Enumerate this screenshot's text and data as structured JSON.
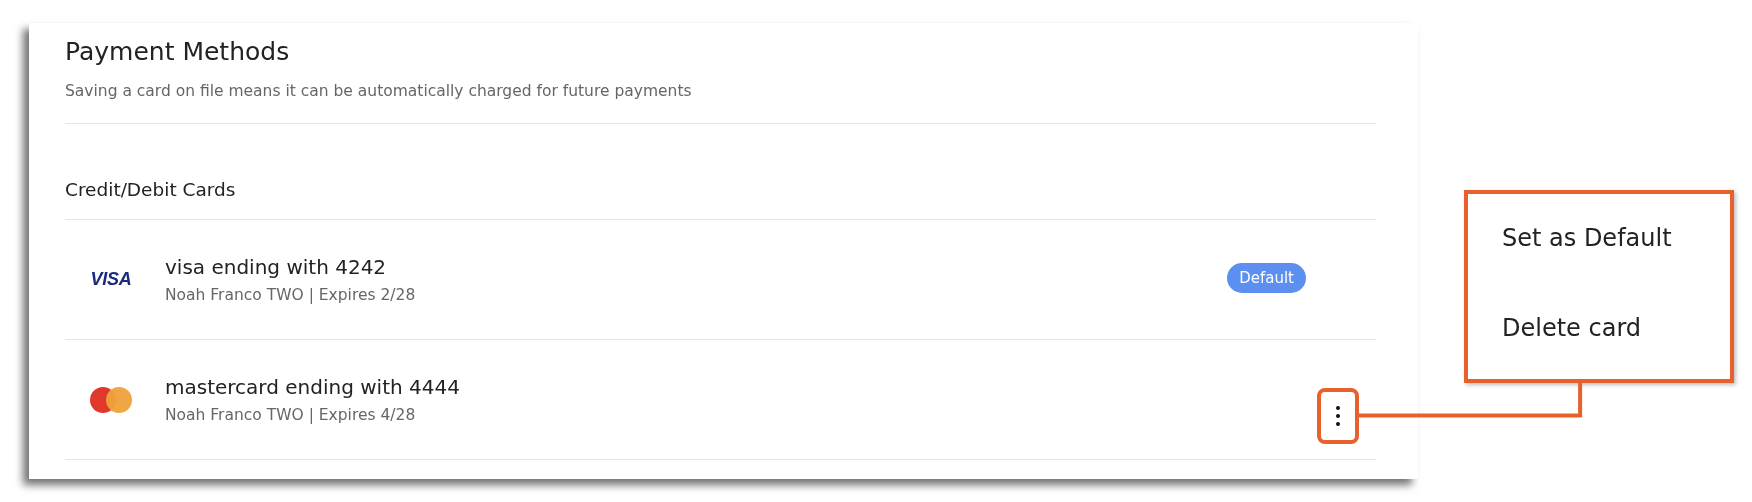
{
  "panel": {
    "title": "Payment Methods",
    "subtitle": "Saving a card on file means it can be automatically charged for future payments",
    "section_heading": "Credit/Debit Cards",
    "cards": [
      {
        "kind": "visa",
        "logo_text": "VISA",
        "title": "visa ending with 4242",
        "details": "Noah Franco TWO | Expires 2/28",
        "badge": "Default",
        "menu_button": false
      },
      {
        "kind": "mastercard",
        "title": "mastercard ending with 4444",
        "details": "Noah Franco TWO | Expires 4/28",
        "menu_button": true
      }
    ]
  },
  "callout": {
    "items": [
      "Set as Default",
      "Delete card"
    ]
  }
}
